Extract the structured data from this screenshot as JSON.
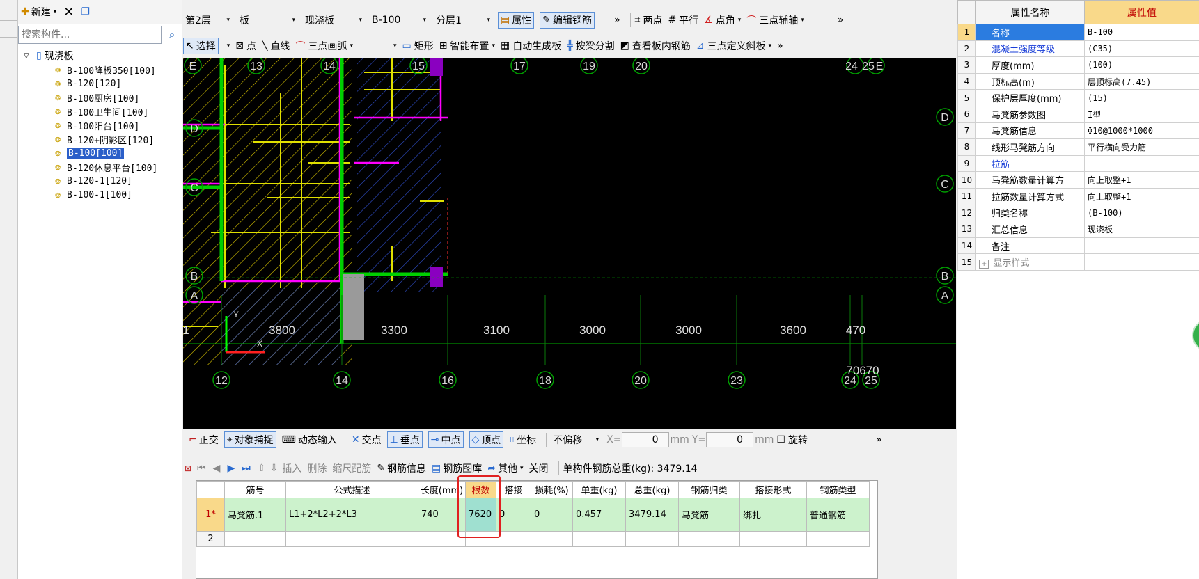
{
  "tree": {
    "new_label": "新建",
    "search_placeholder": "搜索构件...",
    "root_label": "现浇板",
    "items": [
      "B-100降板350[100]",
      "B-120[120]",
      "B-100厨房[100]",
      "B-100卫生间[100]",
      "B-100阳台[100]",
      "B-120+阴影区[120]",
      "B-100[100]",
      "B-120休息平台[100]",
      "B-120-1[120]",
      "B-100-1[100]"
    ],
    "selected_index": 6
  },
  "toolbar1": {
    "floor": "第2层",
    "category": "板",
    "type": "现浇板",
    "component": "B-100",
    "layer": "分层1",
    "property": "属性",
    "edit_rebar": "编辑钢筋",
    "more": "»",
    "two_points": "两点",
    "parallel": "平行",
    "point_angle": "点角",
    "three_point_axis": "三点辅轴",
    "more2": "»"
  },
  "toolbar2": {
    "select": "选择",
    "point": "点",
    "line": "直线",
    "arc": "三点画弧",
    "rect": "矩形",
    "smart": "智能布置",
    "auto_gen": "自动生成板",
    "split_beam": "按梁分割",
    "view_rebar": "查看板内钢筋",
    "slope": "三点定义斜板",
    "more": "»"
  },
  "canvas": {
    "top_axes": [
      "E",
      "13",
      "14",
      "15",
      "17",
      "19",
      "20",
      "24",
      "25",
      "E"
    ],
    "bottom_axes": [
      "12",
      "14",
      "16",
      "18",
      "20",
      "23",
      "24",
      "25"
    ],
    "right_axes": [
      "D",
      "C",
      "B",
      "A"
    ],
    "left_axes": [
      "B",
      "A"
    ],
    "dimensions": [
      "3800",
      "3300",
      "3100",
      "3000",
      "3000",
      "3600",
      "470"
    ],
    "extra_text": "70670",
    "left_fragment": "1",
    "left_axis_labels": [
      "D",
      "C"
    ],
    "y_label": "Y",
    "x_label": "X"
  },
  "snapbar": {
    "ortho": "正交",
    "snap": "对象捕捉",
    "dynamic": "动态输入",
    "intersect": "交点",
    "perp": "垂点",
    "mid": "中点",
    "vertex": "顶点",
    "coord": "坐标",
    "offset": "不偏移",
    "x_label": "X=",
    "x_value": "0",
    "unit": "mm",
    "y_label": "Y=",
    "y_value": "0",
    "rotate": "旋转",
    "more": "»"
  },
  "gridbar": {
    "insert": "插入",
    "delete": "删除",
    "scale": "缩尺配筋",
    "rebar_info": "钢筋信息",
    "rebar_lib": "钢筋图库",
    "other": "其他",
    "close": "关闭",
    "total_label": "单构件钢筋总重(kg): 3479.14"
  },
  "grid": {
    "headers": [
      "筋号",
      "公式描述",
      "长度(mm)",
      "根数",
      "搭接",
      "损耗(%)",
      "单重(kg)",
      "总重(kg)",
      "钢筋归类",
      "搭接形式",
      "钢筋类型"
    ],
    "rows": [
      {
        "idx": "1*",
        "cells": [
          "马凳筋.1",
          "L1+2*L2+2*L3",
          "740",
          "7620",
          "0",
          "0",
          "0.457",
          "3479.14",
          "马凳筋",
          "绑扎",
          "普通钢筋"
        ]
      },
      {
        "idx": "2",
        "cells": [
          "",
          "",
          "",
          "",
          "",
          "",
          "",
          "",
          "",
          "",
          ""
        ]
      }
    ]
  },
  "props": {
    "header_name": "属性名称",
    "header_value": "属性值",
    "rows": [
      {
        "n": "1",
        "name": "名称",
        "value": "B-100",
        "blue": false
      },
      {
        "n": "2",
        "name": "混凝土强度等级",
        "value": "(C35)",
        "blue": true
      },
      {
        "n": "3",
        "name": "厚度(mm)",
        "value": "(100)",
        "blue": false
      },
      {
        "n": "4",
        "name": "顶标高(m)",
        "value": "层顶标高(7.45)",
        "blue": false
      },
      {
        "n": "5",
        "name": "保护层厚度(mm)",
        "value": "(15)",
        "blue": false
      },
      {
        "n": "6",
        "name": "马凳筋参数图",
        "value": "I型",
        "blue": false
      },
      {
        "n": "7",
        "name": "马凳筋信息",
        "value": "Φ10@1000*1000",
        "blue": false
      },
      {
        "n": "8",
        "name": "线形马凳筋方向",
        "value": "平行横向受力筋",
        "blue": false
      },
      {
        "n": "9",
        "name": "拉筋",
        "value": "",
        "blue": true
      },
      {
        "n": "10",
        "name": "马凳筋数量计算方",
        "value": "向上取整+1",
        "blue": false
      },
      {
        "n": "11",
        "name": "拉筋数量计算方式",
        "value": "向上取整+1",
        "blue": false
      },
      {
        "n": "12",
        "name": "归类名称",
        "value": "(B-100)",
        "blue": false
      },
      {
        "n": "13",
        "name": "汇总信息",
        "value": "现浇板",
        "blue": false
      },
      {
        "n": "14",
        "name": "备注",
        "value": "",
        "blue": false
      },
      {
        "n": "15",
        "name": "显示样式",
        "value": "",
        "blue": false
      }
    ]
  },
  "colors": {
    "highlight_box": "#e02020",
    "selected_row": "#2b5fc9",
    "grid_row_bg": "#ccf2cc"
  }
}
